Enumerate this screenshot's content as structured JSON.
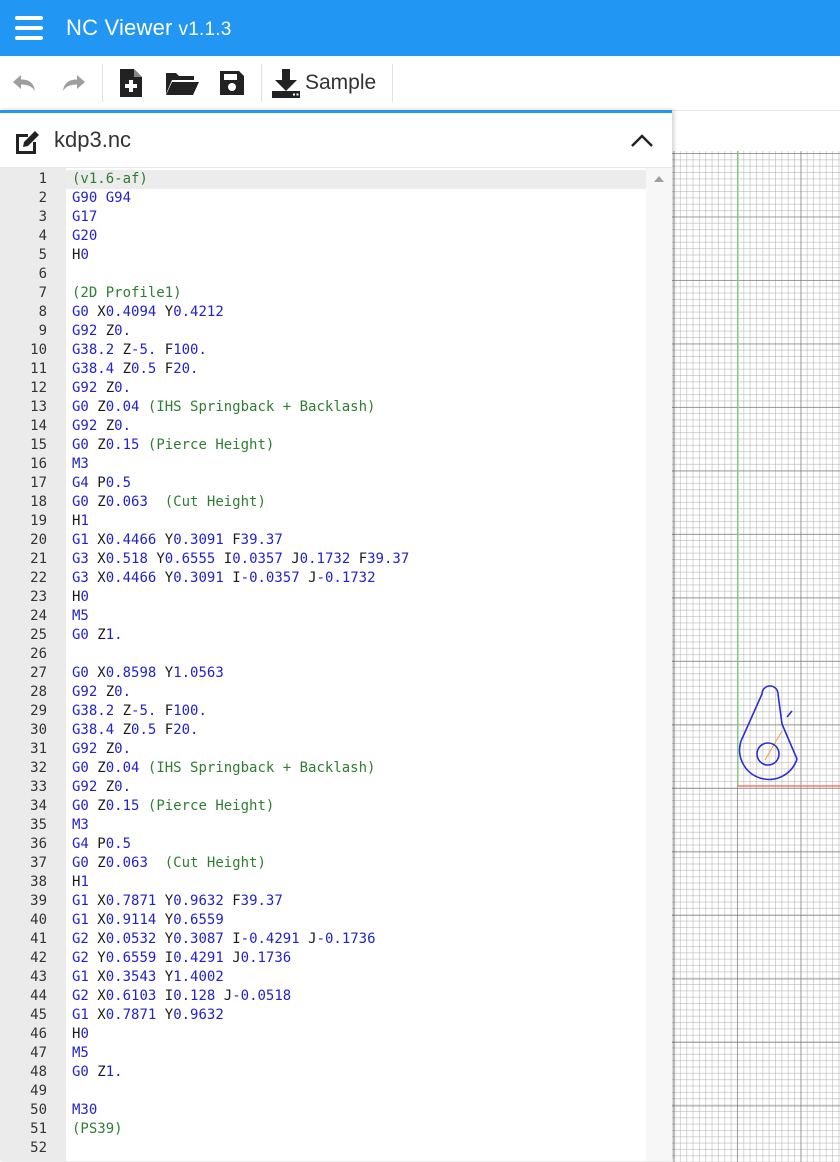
{
  "app": {
    "title": "NC Viewer",
    "version": "v1.1.3",
    "accent_color": "#2196f3"
  },
  "toolbar": {
    "undo_icon": "undo-icon",
    "redo_icon": "redo-icon",
    "new_file_icon": "new-file-icon",
    "open_icon": "folder-open-icon",
    "save_icon": "save-icon",
    "sample_icon": "download-icon",
    "sample_label": "Sample"
  },
  "editor": {
    "file_name": "kdp3.nc",
    "active_line": 1,
    "lines": [
      "(v1.6-af)",
      "G90 G94",
      "G17",
      "G20",
      "H0",
      "",
      "(2D Profile1)",
      "G0 X0.4094 Y0.4212",
      "G92 Z0.",
      "G38.2 Z-5. F100.",
      "G38.4 Z0.5 F20.",
      "G92 Z0.",
      "G0 Z0.04 (IHS Springback + Backlash)",
      "G92 Z0.",
      "G0 Z0.15 (Pierce Height)",
      "M3",
      "G4 P0.5",
      "G0 Z0.063  (Cut Height)",
      "H1",
      "G1 X0.4466 Y0.3091 F39.37",
      "G3 X0.518 Y0.6555 I0.0357 J0.1732 F39.37",
      "G3 X0.4466 Y0.3091 I-0.0357 J-0.1732",
      "H0",
      "M5",
      "G0 Z1.",
      "",
      "G0 X0.8598 Y1.0563",
      "G92 Z0.",
      "G38.2 Z-5. F100.",
      "G38.4 Z0.5 F20.",
      "G92 Z0.",
      "G0 Z0.04 (IHS Springback + Backlash)",
      "G92 Z0.",
      "G0 Z0.15 (Pierce Height)",
      "M3",
      "G4 P0.5",
      "G0 Z0.063  (Cut Height)",
      "H1",
      "G1 X0.7871 Y0.9632 F39.37",
      "G1 X0.9114 Y0.6559",
      "G2 X0.0532 Y0.3087 I-0.4291 J-0.1736",
      "G2 Y0.6559 I0.4291 J0.1736",
      "G1 X0.3543 Y1.4002",
      "G2 X0.6103 I0.128 J-0.0518",
      "G1 X0.7871 Y0.9632",
      "H0",
      "M5",
      "G0 Z1.",
      "",
      "M30",
      "(PS39)",
      ""
    ]
  },
  "viewport": {
    "x_axis_color": "#ff5a4a",
    "y_axis_color": "#7ee07e",
    "toolpath_color": "#2c2cd8",
    "rapid_color": "#f0a050"
  }
}
